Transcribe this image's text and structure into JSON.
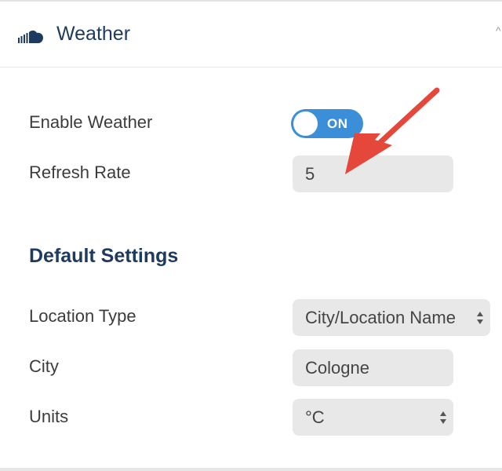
{
  "header": {
    "title": "Weather",
    "icon": "cloud-icon",
    "corner_glyph": "^"
  },
  "settings": {
    "enable_label": "Enable Weather",
    "enable_toggle_text": "ON",
    "enable_state": true,
    "refresh_label": "Refresh Rate",
    "refresh_value": "5"
  },
  "default_settings": {
    "title": "Default Settings",
    "location_type_label": "Location Type",
    "location_type_value": "City/Location Name",
    "city_label": "City",
    "city_value": "Cologne",
    "units_label": "Units",
    "units_value": "°C"
  },
  "colors": {
    "accent": "#3b8fd8",
    "title": "#1e3a5f",
    "annotation_arrow": "#e5473a"
  }
}
